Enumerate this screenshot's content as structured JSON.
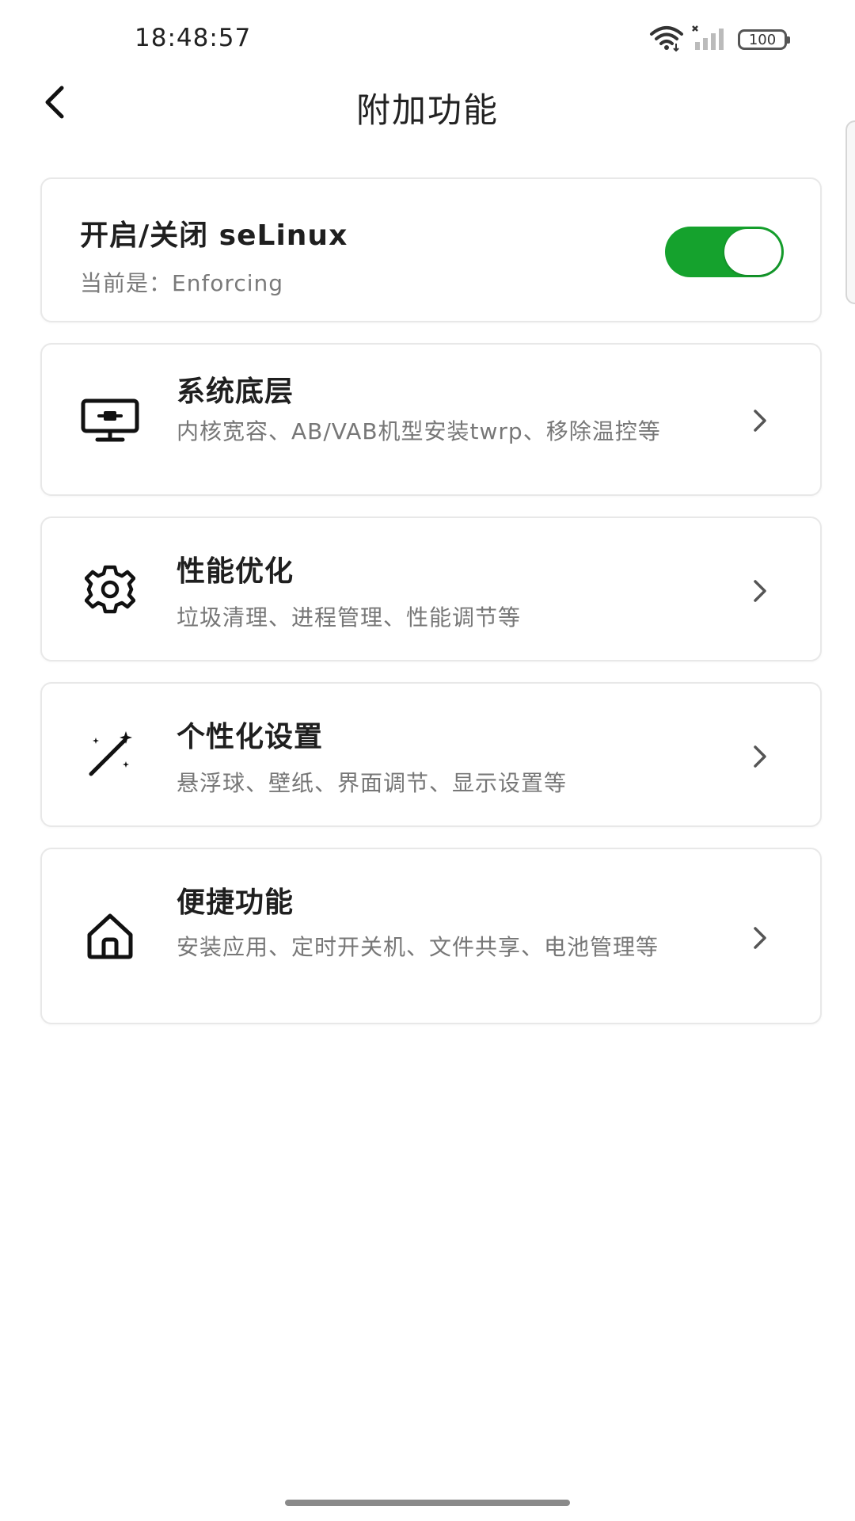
{
  "status_bar": {
    "time": "18:48:57",
    "battery": "100"
  },
  "header": {
    "title": "附加功能"
  },
  "selinux": {
    "title": "开启/关闭 seLinux",
    "status": "当前是：Enforcing",
    "toggle_on": true,
    "toggle_color": "#15a22d"
  },
  "items": [
    {
      "icon": "monitor-icon",
      "title": "系统底层",
      "desc": "内核宽容、AB/VAB机型安装twrp、移除温控等"
    },
    {
      "icon": "gear-icon",
      "title": "性能优化",
      "desc": "垃圾清理、进程管理、性能调节等"
    },
    {
      "icon": "magic-wand-icon",
      "title": "个性化设置",
      "desc": "悬浮球、壁纸、界面调节、显示设置等"
    },
    {
      "icon": "home-icon",
      "title": "便捷功能",
      "desc": "安装应用、定时开关机、文件共享、电池管理等"
    }
  ]
}
